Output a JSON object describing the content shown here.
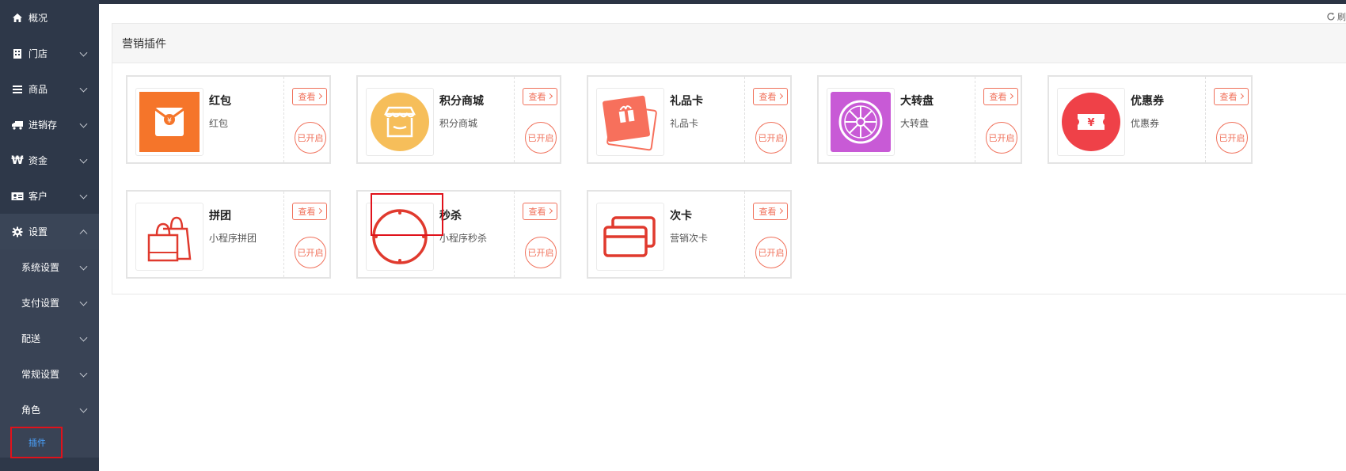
{
  "sidebar": {
    "items": [
      {
        "label": "概况",
        "icon": "home-icon"
      },
      {
        "label": "门店",
        "icon": "building-icon"
      },
      {
        "label": "商品",
        "icon": "list-icon"
      },
      {
        "label": "进销存",
        "icon": "truck-icon"
      },
      {
        "label": "资金",
        "icon": "won-icon"
      },
      {
        "label": "客户",
        "icon": "id-card-icon"
      },
      {
        "label": "设置",
        "icon": "gear-icon"
      }
    ],
    "settings_sub": [
      {
        "label": "系统设置"
      },
      {
        "label": "支付设置"
      },
      {
        "label": "配送"
      },
      {
        "label": "常规设置"
      },
      {
        "label": "角色"
      },
      {
        "label": "插件"
      }
    ]
  },
  "header": {
    "refresh_label": "刷"
  },
  "panel": {
    "title": "营销插件"
  },
  "plugins": [
    {
      "name": "红包",
      "desc": "红包",
      "icon": "red-envelope-icon",
      "color": "#f5752a",
      "view": "查看",
      "status": "已开启"
    },
    {
      "name": "积分商城",
      "desc": "积分商城",
      "icon": "store-icon",
      "color": "#f6be5a",
      "view": "查看",
      "status": "已开启"
    },
    {
      "name": "礼品卡",
      "desc": "礼品卡",
      "icon": "gift-card-icon",
      "color": "#f7705c",
      "view": "查看",
      "status": "已开启"
    },
    {
      "name": "大转盘",
      "desc": "大转盘",
      "icon": "wheel-icon",
      "color": "#c85ad6",
      "view": "查看",
      "status": "已开启"
    },
    {
      "name": "优惠券",
      "desc": "优惠券",
      "icon": "coupon-icon",
      "color": "#ef4148",
      "view": "查看",
      "status": "已开启"
    },
    {
      "name": "拼团",
      "desc": "小程序拼团",
      "icon": "shopping-bags-icon",
      "color": "#e03a2e",
      "view": "查看",
      "status": "已开启"
    },
    {
      "name": "秒杀",
      "desc": "小程序秒杀",
      "icon": "flash-sale-icon",
      "color": "#e03a2e",
      "view": "查看",
      "status": "已开启"
    },
    {
      "name": "次卡",
      "desc": "营销次卡",
      "icon": "cards-icon",
      "color": "#e03a2e",
      "view": "查看",
      "status": "已开启"
    }
  ]
}
